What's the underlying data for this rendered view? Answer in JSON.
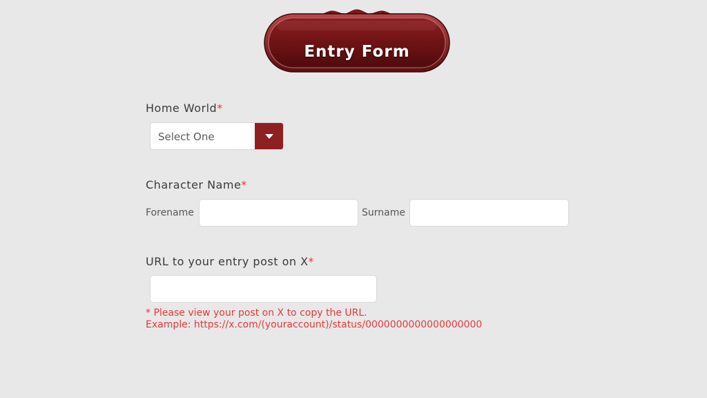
{
  "header": {
    "title": "Entry Form"
  },
  "form": {
    "home_world": {
      "label": "Home World",
      "required_mark": "*",
      "selected": "Select One"
    },
    "character_name": {
      "label": "Character Name",
      "required_mark": "*",
      "forename_label": "Forename",
      "forename_value": "",
      "surname_label": "Surname",
      "surname_value": ""
    },
    "url": {
      "label": "URL to your entry post on X",
      "required_mark": "*",
      "value": "",
      "note_line1": "* Please view your post on X to copy the URL.",
      "note_line2": "Example: https://x.com/(youraccount)/status/0000000000000000000"
    }
  },
  "colors": {
    "background": "#e9e8e8",
    "accent": "#8e1f22",
    "required": "#e5383b"
  }
}
